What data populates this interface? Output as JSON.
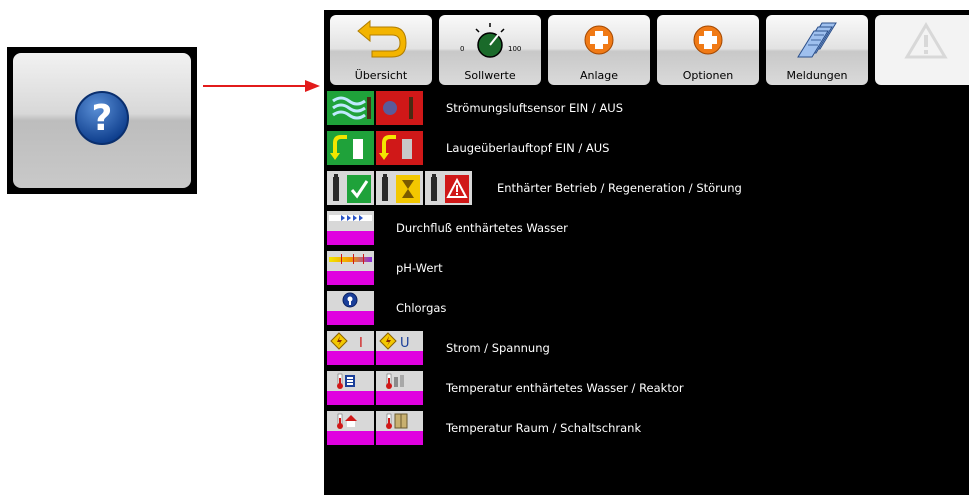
{
  "toolbar": {
    "buttons": [
      {
        "label": "Übersicht",
        "icon": "undo-arrow-icon"
      },
      {
        "label": "Sollwerte",
        "icon": "dial-knob-icon",
        "dial_min": "0",
        "dial_max": "100"
      },
      {
        "label": "Anlage",
        "icon": "plus-circle-icon"
      },
      {
        "label": "Optionen",
        "icon": "plus-circle-icon"
      },
      {
        "label": "Meldungen",
        "icon": "documents-icon"
      },
      {
        "label": "",
        "icon": "warning-icon",
        "disabled": true
      }
    ]
  },
  "legend": [
    {
      "label": "Strömungsluftsensor EIN / AUS"
    },
    {
      "label": "Laugeüberlauftopf EIN / AUS"
    },
    {
      "label": "Enthärter Betrieb / Regeneration / Störung"
    },
    {
      "label": "Durchfluß enthärtetes Wasser"
    },
    {
      "label": "pH-Wert"
    },
    {
      "label": "Chlorgas"
    },
    {
      "label": "Strom / Spannung",
      "icon_a": "I",
      "icon_b": "U"
    },
    {
      "label": "Temperatur enthärtetes Wasser / Reaktor"
    },
    {
      "label": "Temperatur Raum / Schaltschrank"
    }
  ],
  "colors": {
    "on_green": "#1fa23a",
    "off_red": "#d01818",
    "magenta": "#e000e0",
    "arrow_red": "#e21b1b",
    "panel_bg": "#000000"
  }
}
